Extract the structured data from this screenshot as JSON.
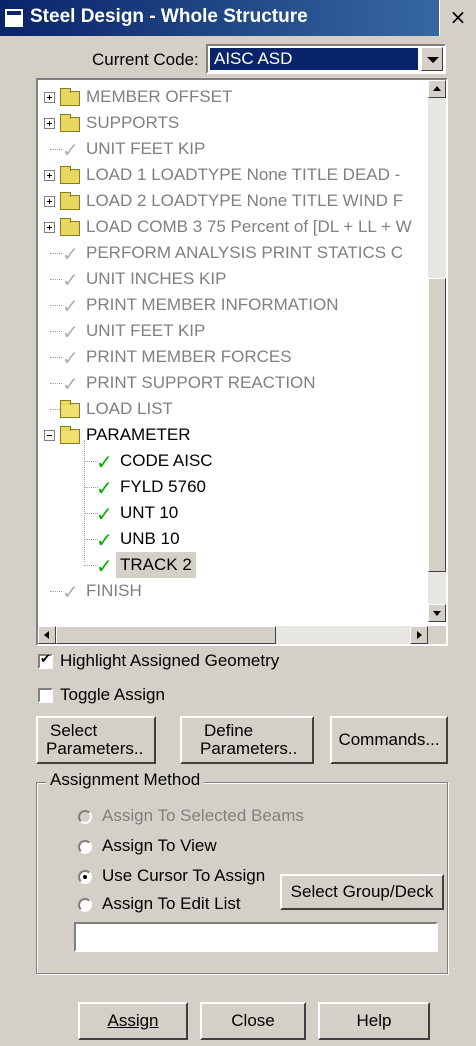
{
  "window": {
    "title": "Steel Design - Whole Structure",
    "close_glyph": "×"
  },
  "code": {
    "label": "Current Code:",
    "value": "AISC ASD"
  },
  "tree": {
    "items": [
      {
        "label": "MEMBER OFFSET",
        "icon": "folder-icon",
        "expander": "plus",
        "state": "gray"
      },
      {
        "label": "SUPPORTS",
        "icon": "folder-icon",
        "expander": "plus",
        "state": "gray"
      },
      {
        "label": "UNIT FEET KIP",
        "icon": "check-icon",
        "state": "gray"
      },
      {
        "label": "LOAD 1 LOADTYPE None  TITLE DEAD -",
        "icon": "folder-icon",
        "expander": "plus",
        "state": "gray"
      },
      {
        "label": "LOAD 2 LOADTYPE None  TITLE WIND F",
        "icon": "folder-icon",
        "expander": "plus",
        "state": "gray"
      },
      {
        "label": "LOAD COMB 3 75 Percent of [DL + LL + W",
        "icon": "folder-icon",
        "expander": "plus",
        "state": "gray"
      },
      {
        "label": "PERFORM ANALYSIS PRINT STATICS C",
        "icon": "check-icon",
        "state": "gray"
      },
      {
        "label": "UNIT INCHES KIP",
        "icon": "check-icon",
        "state": "gray"
      },
      {
        "label": "PRINT MEMBER INFORMATION",
        "icon": "check-icon",
        "state": "gray"
      },
      {
        "label": "UNIT FEET KIP",
        "icon": "check-icon",
        "state": "gray"
      },
      {
        "label": "PRINT MEMBER FORCES",
        "icon": "check-icon",
        "state": "gray"
      },
      {
        "label": "PRINT SUPPORT REACTION",
        "icon": "check-icon",
        "state": "gray"
      },
      {
        "label": "LOAD LIST",
        "icon": "open-folder-icon",
        "state": "gray"
      },
      {
        "label": "PARAMETER",
        "icon": "open-folder-icon",
        "expander": "minus",
        "state": "dark"
      },
      {
        "label": "CODE AISC",
        "icon": "check-icon",
        "state": "dark",
        "child": true
      },
      {
        "label": "FYLD 5760",
        "icon": "check-icon",
        "state": "dark",
        "child": true
      },
      {
        "label": "UNT 10",
        "icon": "check-icon",
        "state": "dark",
        "child": true
      },
      {
        "label": "UNB 10",
        "icon": "check-icon",
        "state": "dark",
        "child": true
      },
      {
        "label": "TRACK 2",
        "icon": "check-icon",
        "state": "selected",
        "child": true
      },
      {
        "label": "FINISH",
        "icon": "check-icon",
        "state": "gray"
      }
    ]
  },
  "options": {
    "highlight_label": "Highlight Assigned Geometry",
    "highlight_checked": true,
    "toggle_label": "Toggle Assign",
    "toggle_checked": false
  },
  "buttons": {
    "select_line1": "Select",
    "select_line2": "Parameters..",
    "define_line1": "Define",
    "define_line2": "Parameters..",
    "commands": "Commands...",
    "select_group": "Select Group/Deck",
    "assign": "Assign",
    "close": "Close",
    "help": "Help"
  },
  "assignment": {
    "title": "Assignment Method",
    "options": [
      {
        "label": "Assign To Selected Beams",
        "selected": false,
        "enabled": false
      },
      {
        "label": "Assign To View",
        "selected": false,
        "enabled": true
      },
      {
        "label": "Use Cursor To Assign",
        "selected": true,
        "enabled": true
      },
      {
        "label": "Assign To Edit List",
        "selected": false,
        "enabled": true
      }
    ],
    "edit_list_value": ""
  }
}
